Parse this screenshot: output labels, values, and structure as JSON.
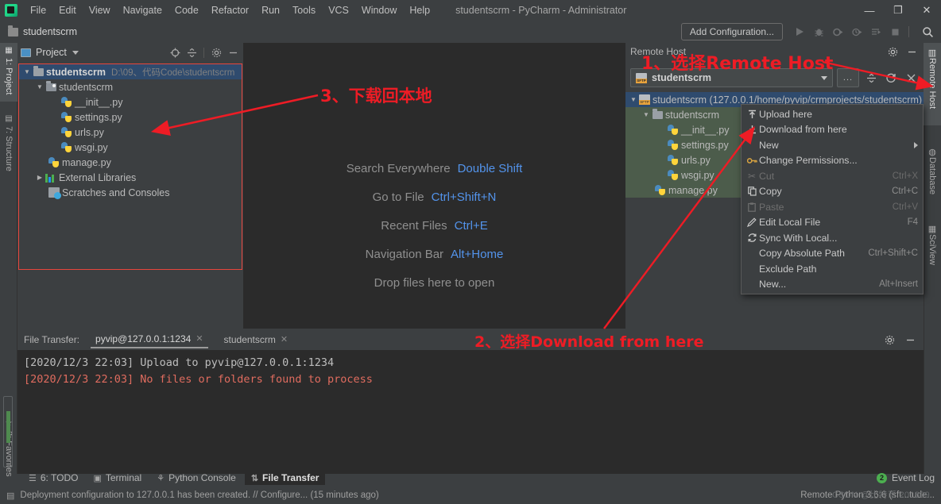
{
  "window": {
    "title": "studentscrm - PyCharm - Administrator",
    "logo_icon": "pycharm-logo-icon",
    "minimize": "—",
    "maximize": "❐",
    "close": "✕"
  },
  "menubar": {
    "items": [
      {
        "label": "File"
      },
      {
        "label": "Edit"
      },
      {
        "label": "View"
      },
      {
        "label": "Navigate"
      },
      {
        "label": "Code"
      },
      {
        "label": "Refactor"
      },
      {
        "label": "Run"
      },
      {
        "label": "Tools"
      },
      {
        "label": "VCS"
      },
      {
        "label": "Window"
      },
      {
        "label": "Help"
      }
    ]
  },
  "navbar": {
    "folder_icon": "folder-icon",
    "crumb": "studentscrm"
  },
  "toolbar": {
    "add_configuration": "Add Configuration...",
    "run_icon": "run-icon",
    "debug_icon": "debug-icon",
    "coverage_icon": "run-with-coverage-icon",
    "profile_icon": "profile-icon",
    "run_dashboard_icon": "run-dashboard-icon",
    "stop_icon": "stop-icon",
    "search_icon": "search-icon"
  },
  "left_strip": {
    "tabs": [
      {
        "label": "1: Project",
        "icon": "project-icon",
        "active": true
      },
      {
        "label": "7: Structure",
        "icon": "structure-icon",
        "active": false
      },
      {
        "label": "2: Favorites",
        "icon": "star-icon",
        "active": false
      }
    ]
  },
  "right_strip": {
    "tabs": [
      {
        "label": "Remote Host",
        "icon": "remote-host-icon",
        "active": true
      },
      {
        "label": "Database",
        "icon": "database-icon",
        "active": false
      },
      {
        "label": "SciView",
        "icon": "sciview-icon",
        "active": false
      }
    ]
  },
  "project_panel": {
    "title": "Project",
    "title_icon": "project-icon",
    "dropdown_icon": "chevron-down-icon",
    "icons": [
      {
        "name": "locate-icon",
        "glyph": "⊕"
      },
      {
        "name": "collapse-all-icon",
        "glyph": "≡"
      },
      {
        "name": "gear-icon",
        "glyph": "⚙"
      },
      {
        "name": "hide-icon",
        "glyph": "—"
      }
    ],
    "tree": [
      {
        "label": "studentscrm",
        "path": "D:\\09、代码Code\\studentscrm",
        "icon": "folder-icon",
        "indent": 0,
        "arrow": "down",
        "bold": true,
        "selected": true
      },
      {
        "label": "studentscrm",
        "path": "",
        "icon": "source-folder-icon",
        "indent": 1,
        "arrow": "down",
        "bold": false,
        "selected": false
      },
      {
        "label": "__init__.py",
        "path": "",
        "icon": "python-file-icon",
        "indent": 2,
        "arrow": "",
        "bold": false,
        "selected": false
      },
      {
        "label": "settings.py",
        "path": "",
        "icon": "python-file-icon",
        "indent": 2,
        "arrow": "",
        "bold": false,
        "selected": false
      },
      {
        "label": "urls.py",
        "path": "",
        "icon": "python-file-icon",
        "indent": 2,
        "arrow": "",
        "bold": false,
        "selected": false
      },
      {
        "label": "wsgi.py",
        "path": "",
        "icon": "python-file-icon",
        "indent": 2,
        "arrow": "",
        "bold": false,
        "selected": false
      },
      {
        "label": "manage.py",
        "path": "",
        "icon": "python-file-icon",
        "indent": 1,
        "arrow": "",
        "bold": false,
        "selected": false
      },
      {
        "label": "External Libraries",
        "path": "",
        "icon": "library-icon",
        "indent": 1,
        "arrow": "right",
        "bold": false,
        "selected": false
      },
      {
        "label": "Scratches and Consoles",
        "path": "",
        "icon": "scratches-icon",
        "indent": 1,
        "arrow": "",
        "bold": false,
        "selected": false
      }
    ]
  },
  "editor": {
    "welcome": [
      {
        "action": "Search Everywhere",
        "shortcut": "Double Shift"
      },
      {
        "action": "Go to File",
        "shortcut": "Ctrl+Shift+N"
      },
      {
        "action": "Recent Files",
        "shortcut": "Ctrl+E"
      },
      {
        "action": "Navigation Bar",
        "shortcut": "Alt+Home"
      },
      {
        "action": "Drop files here to open",
        "shortcut": ""
      }
    ]
  },
  "remote_panel": {
    "title": "Remote Host",
    "head_icons": [
      {
        "name": "gear-icon",
        "glyph": "⚙"
      },
      {
        "name": "hide-icon",
        "glyph": "—"
      }
    ],
    "deployment_value": "studentscrm",
    "deployment_icon": "sftp-icon",
    "dropdown_icon": "chevron-down-icon",
    "browse_label": "...",
    "toolbar_icons": [
      {
        "name": "collapse-all-icon",
        "glyph": "≡"
      },
      {
        "name": "refresh-icon",
        "glyph": "↻"
      },
      {
        "name": "close-icon",
        "glyph": "✕"
      }
    ],
    "tree": [
      {
        "label": "studentscrm (127.0.0.1/home/pyvip/crmprojects/studentscrm)",
        "icon": "sftp-icon",
        "indent": 0,
        "arrow": "down",
        "selected": true,
        "green": false
      },
      {
        "label": "studentscrm",
        "icon": "folder-icon",
        "indent": 1,
        "arrow": "down",
        "selected": false,
        "green": true
      },
      {
        "label": "__init__.py",
        "icon": "python-file-icon",
        "indent": 2,
        "arrow": "",
        "selected": false,
        "green": true
      },
      {
        "label": "settings.py",
        "icon": "python-file-icon",
        "indent": 2,
        "arrow": "",
        "selected": false,
        "green": true
      },
      {
        "label": "urls.py",
        "icon": "python-file-icon",
        "indent": 2,
        "arrow": "",
        "selected": false,
        "green": true
      },
      {
        "label": "wsgi.py",
        "icon": "python-file-icon",
        "indent": 2,
        "arrow": "",
        "selected": false,
        "green": true
      },
      {
        "label": "manage.py",
        "icon": "python-file-icon",
        "indent": 1,
        "arrow": "",
        "selected": false,
        "green": true
      }
    ]
  },
  "context_menu": {
    "items": [
      {
        "label": "Upload here",
        "underline": "U",
        "shortcut": "",
        "icon": "upload-icon",
        "disabled": false,
        "submenu": false
      },
      {
        "label": "Download from here",
        "underline": "D",
        "shortcut": "",
        "icon": "download-icon",
        "disabled": false,
        "submenu": false
      },
      {
        "label": "New",
        "underline": "N",
        "shortcut": "",
        "icon": "",
        "disabled": false,
        "submenu": true
      },
      {
        "label": "Change Permissions...",
        "underline": "P",
        "shortcut": "",
        "icon": "key-icon",
        "disabled": false,
        "submenu": false
      },
      {
        "label": "Cut",
        "underline": "",
        "shortcut": "Ctrl+X",
        "icon": "scissors-icon",
        "disabled": true,
        "submenu": false
      },
      {
        "label": "Copy",
        "underline": "C",
        "shortcut": "Ctrl+C",
        "icon": "copy-icon",
        "disabled": false,
        "submenu": false
      },
      {
        "label": "Paste",
        "underline": "",
        "shortcut": "Ctrl+V",
        "icon": "clipboard-icon",
        "disabled": true,
        "submenu": false
      },
      {
        "label": "Edit Local File",
        "underline": "",
        "shortcut": "F4",
        "icon": "pencil-icon",
        "disabled": false,
        "submenu": false
      },
      {
        "label": "Sync With Local...",
        "underline": "S",
        "shortcut": "",
        "icon": "sync-icon",
        "disabled": false,
        "submenu": false
      },
      {
        "label": "Copy Absolute Path",
        "underline": "o",
        "shortcut": "Ctrl+Shift+C",
        "icon": "",
        "disabled": false,
        "submenu": false
      },
      {
        "label": "Exclude Path",
        "underline": "l",
        "shortcut": "",
        "icon": "",
        "disabled": false,
        "submenu": false
      },
      {
        "label": "New...",
        "underline": "",
        "shortcut": "Alt+Insert",
        "icon": "",
        "disabled": false,
        "submenu": false
      }
    ]
  },
  "file_transfer": {
    "label": "File Transfer:",
    "tabs": [
      {
        "label": "pyvip@127.0.0.1:1234",
        "active": true,
        "close_icon": "close-icon"
      },
      {
        "label": "studentscrm",
        "active": false,
        "close_icon": "close-icon"
      }
    ],
    "head_icons": [
      {
        "name": "gear-icon",
        "glyph": "⚙"
      },
      {
        "name": "hide-icon",
        "glyph": "—"
      }
    ],
    "console_lines": [
      {
        "text": "[2020/12/3 22:03] Upload to pyvip@127.0.0.1:1234",
        "color": "white"
      },
      {
        "text": "[2020/12/3 22:03] No files or folders found to process",
        "color": "red"
      }
    ]
  },
  "bottom_tabs": {
    "tabs": [
      {
        "label": "6: TODO",
        "icon": "todo-icon",
        "active": false
      },
      {
        "label": "Terminal",
        "icon": "terminal-icon",
        "active": false
      },
      {
        "label": "Python Console",
        "icon": "python-console-icon",
        "active": false
      },
      {
        "label": "File Transfer",
        "icon": "file-transfer-icon",
        "active": true
      }
    ],
    "event_log": {
      "label": "Event Log",
      "count": "2"
    }
  },
  "statusbar": {
    "icon": "document-icon",
    "message": "Deployment configuration to 127.0.0.1 has been created. // Configure... (15 minutes ago)",
    "interpreter": "Remote Python 3.6.6 (sft...tude...",
    "watermark": "CSDN @比特币 201809"
  },
  "annotations": [
    {
      "id": 1,
      "text": "1、选择Remote Host"
    },
    {
      "id": 2,
      "text": "2、选择Download from here"
    },
    {
      "id": 3,
      "text": "3、下载回本地"
    }
  ],
  "colors": {
    "accent_red": "#ee1c25",
    "selection_blue": "#2f4b6e",
    "link_blue": "#5394ec",
    "console_red": "#e06c5f",
    "panel_bg": "#3c3f41",
    "editor_bg": "#2b2b2b"
  }
}
